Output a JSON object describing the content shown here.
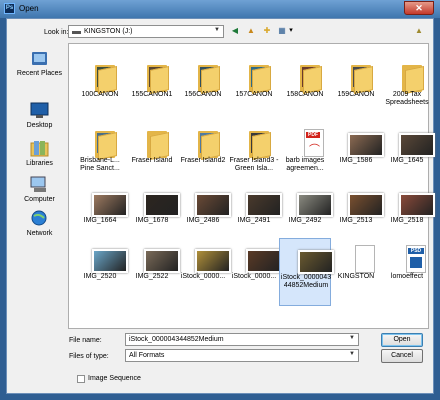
{
  "window": {
    "title": "Open",
    "close_glyph": "✕",
    "app_icon": "Ps"
  },
  "lookin": {
    "label": "Look in:",
    "value": "KINGSTON (J:)"
  },
  "toolbar": {
    "back_glyph": "◀",
    "up_glyph": "▲",
    "newfolder_glyph": "✚",
    "views_glyph": "▦",
    "views_arrow": "▾",
    "extra_glyph": "▲"
  },
  "places": [
    {
      "label": "Recent Places"
    },
    {
      "label": "Desktop"
    },
    {
      "label": "Libraries"
    },
    {
      "label": "Computer"
    },
    {
      "label": "Network"
    }
  ],
  "items": [
    {
      "label": "100CANON",
      "kind": "folder",
      "tint": "#3f4f3a"
    },
    {
      "label": "155CANON1",
      "kind": "folder",
      "tint": "#5a4630"
    },
    {
      "label": "156CANON",
      "kind": "folder",
      "tint": "#32505c"
    },
    {
      "label": "157CANON",
      "kind": "folder",
      "tint": "#2e6a86"
    },
    {
      "label": "158CANON",
      "kind": "folder",
      "tint": "#6a3a2c"
    },
    {
      "label": "159CANON",
      "kind": "folder",
      "tint": "#4a4a4a"
    },
    {
      "label": "2009 Tax Spreadsheets",
      "kind": "folder",
      "tint": ""
    },
    {
      "label": "Brisbane-L... Pine Sanct...",
      "kind": "folder",
      "tint": "#4a6e86"
    },
    {
      "label": "Fraser Island",
      "kind": "folder",
      "tint": ""
    },
    {
      "label": "Fraser Island2",
      "kind": "folder",
      "tint": "#4f7aa0"
    },
    {
      "label": "Fraser Island3 - Green Isla...",
      "kind": "folder",
      "tint": "#3a3a3a"
    },
    {
      "label": "barb images agreemen...",
      "kind": "pdf",
      "tint": "#d2231b"
    },
    {
      "label": "IMG_1586",
      "kind": "photo",
      "tint": "#8b6a52"
    },
    {
      "label": "IMG_1645",
      "kind": "photo",
      "tint": "#5a4838"
    },
    {
      "label": "IMG_1664",
      "kind": "photo",
      "tint": "#9d7a60"
    },
    {
      "label": "IMG_1678",
      "kind": "photo",
      "tint": "#2d2620"
    },
    {
      "label": "IMG_2486",
      "kind": "photo",
      "tint": "#6a4a36"
    },
    {
      "label": "IMG_2491",
      "kind": "photo",
      "tint": "#4a3a2c"
    },
    {
      "label": "IMG_2492",
      "kind": "photo",
      "tint": "#8a8a80"
    },
    {
      "label": "IMG_2513",
      "kind": "photo",
      "tint": "#7a5030"
    },
    {
      "label": "IMG_2518",
      "kind": "photo",
      "tint": "#8a4a3a"
    },
    {
      "label": "IMG_2520",
      "kind": "photo",
      "tint": "#6aa6c8"
    },
    {
      "label": "IMG_2522",
      "kind": "photo",
      "tint": "#7a6a58"
    },
    {
      "label": "iStock_0000...",
      "kind": "photo",
      "tint": "#b0903a"
    },
    {
      "label": "iStock_0000...",
      "kind": "photo",
      "tint": "#5a3a26"
    },
    {
      "label": "iStock_000004344852Medium",
      "kind": "photo",
      "tint": "#6a5a30"
    },
    {
      "label": "KINGSTON",
      "kind": "doc",
      "tint": ""
    },
    {
      "label": "lomoeffect",
      "kind": "psd",
      "tint": "#1f5fa8"
    }
  ],
  "filename": {
    "label": "File name:",
    "value": "iStock_000004344852Medium"
  },
  "filetype": {
    "label": "Files of type:",
    "value": "All Formats"
  },
  "buttons": {
    "open": "Open",
    "cancel": "Cancel"
  },
  "sequence": {
    "label": "Image Sequence"
  },
  "colors": {
    "selection": "#d5e6fb",
    "titlebar": "#4f86bf",
    "folder": "#f4d06c"
  }
}
